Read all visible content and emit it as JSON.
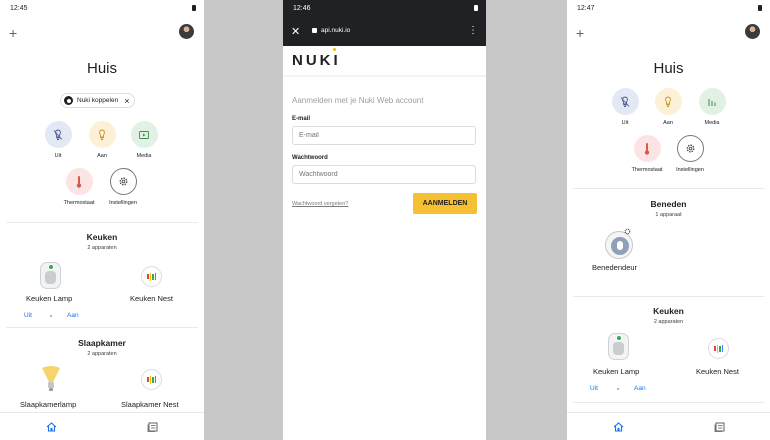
{
  "screen1": {
    "time": "12:45",
    "title": "Huis",
    "chip_label": "Nuki koppelen",
    "actions": [
      {
        "label": "Uit",
        "icon": "light-off-icon"
      },
      {
        "label": "Aan",
        "icon": "lightbulb-icon"
      },
      {
        "label": "Media",
        "icon": "media-play-icon"
      },
      {
        "label": "Thermostaat",
        "icon": "thermometer-icon"
      },
      {
        "label": "Instellingen",
        "icon": "gear-icon"
      }
    ],
    "rooms": [
      {
        "name": "Keuken",
        "count": "2 apparaten",
        "devices": [
          "Keuken Lamp",
          "Keuken Nest"
        ],
        "controls": [
          "Uit",
          "Aan"
        ]
      },
      {
        "name": "Slaapkamer",
        "count": "2 apparaten",
        "devices": [
          "Slaapkamerlamp",
          "Slaapkamer Nest"
        ]
      }
    ]
  },
  "screen2": {
    "time": "12:46",
    "url": "api.nuki.io",
    "logo": "NUKI",
    "heading": "Aanmelden met je Nuki Web account",
    "email_label": "E-mail",
    "email_placeholder": "E-mail",
    "password_label": "Wachtwoord",
    "password_placeholder": "Wachtwoord",
    "forgot_link": "Wachtwoord vergeten?",
    "submit_label": "AANMELDEN"
  },
  "screen3": {
    "time": "12:47",
    "title": "Huis",
    "actions": [
      {
        "label": "Uit",
        "icon": "light-off-icon"
      },
      {
        "label": "Aan",
        "icon": "lightbulb-icon"
      },
      {
        "label": "Media",
        "icon": "equalizer-icon"
      },
      {
        "label": "Thermostaat",
        "icon": "thermometer-icon"
      },
      {
        "label": "Instellingen",
        "icon": "gear-icon"
      }
    ],
    "rooms": [
      {
        "name": "Beneden",
        "count": "1 apparaat",
        "devices": [
          "Benedendeur"
        ]
      },
      {
        "name": "Keuken",
        "count": "2 apparaten",
        "devices": [
          "Keuken Lamp",
          "Keuken Nest"
        ],
        "controls": [
          "Uit",
          "Aan"
        ]
      }
    ]
  },
  "colors": {
    "accent": "#1a73e8",
    "nuki_button": "#f6c034",
    "browser_bar": "#202124"
  }
}
